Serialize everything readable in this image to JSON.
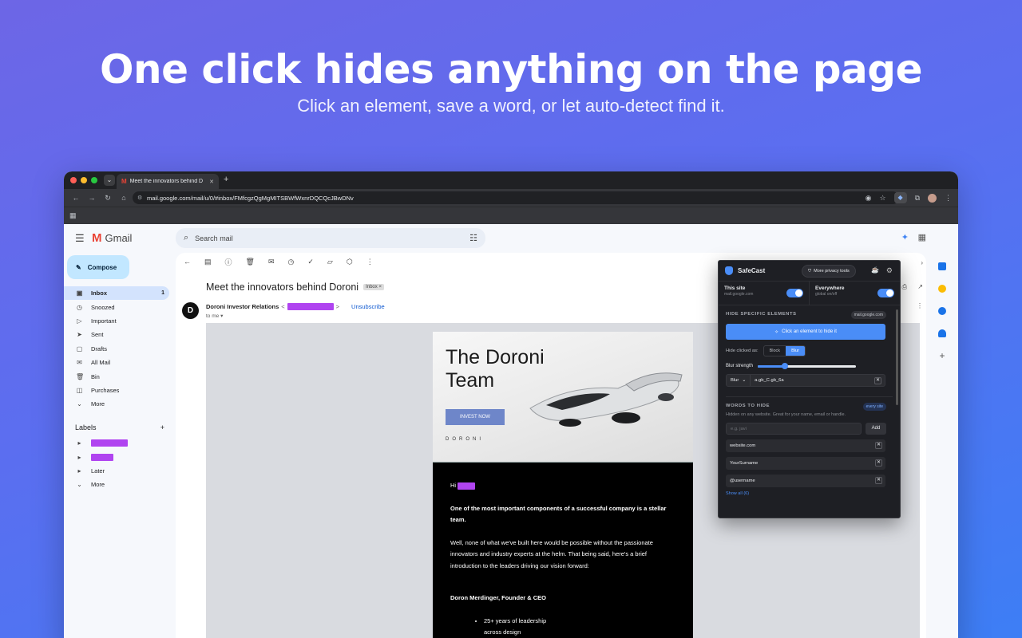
{
  "hero": {
    "title": "One click hides anything on the page",
    "subtitle": "Click an element, save a word, or let auto-detect find it."
  },
  "browser": {
    "tab_title": "Meet the innovators behind D",
    "url": "mail.google.com/mail/u/0/#inbox/FMfcgzQgMgMITSBWfWxnrDQCQcJBwDNv"
  },
  "gmail": {
    "logo": "Gmail",
    "search_placeholder": "Search mail",
    "compose": "Compose",
    "nav": [
      {
        "label": "Inbox",
        "count": "1"
      },
      {
        "label": "Snoozed"
      },
      {
        "label": "Important"
      },
      {
        "label": "Sent"
      },
      {
        "label": "Drafts"
      },
      {
        "label": "All Mail"
      },
      {
        "label": "Bin"
      },
      {
        "label": "Purchases"
      },
      {
        "label": "More"
      }
    ],
    "labels_title": "Labels",
    "labels": [
      {
        "label": "Later"
      },
      {
        "label": "More"
      }
    ]
  },
  "email": {
    "subject": "Meet the innovators behind Doroni",
    "folder_chip": "Inbox",
    "sender": "Doroni Investor Relations",
    "unsubscribe": "Unsubscribe",
    "to": "to me",
    "hero_title_line1": "The Doroni",
    "hero_title_line2": "Team",
    "invest_button": "INVEST NOW",
    "brand": "DORONI",
    "greeting": "Hi",
    "p1": "One of the most important components of a successful company is a stellar team.",
    "p2": "Well, none of what we've built here would be possible without the passionate innovators and industry experts at the helm. That being said, here's a brief introduction to the leaders driving our vision forward:",
    "p3": "Doron Merdinger, Founder & CEO",
    "bullet1": "25+ years of leadership",
    "bullet1b": "across design"
  },
  "safecast": {
    "name": "SafeCast",
    "more_tools": "More privacy tools",
    "this_site": {
      "title": "This site",
      "sub": "mail.google.com"
    },
    "everywhere": {
      "title": "Everywhere",
      "sub": "global on/off"
    },
    "hide_section": "HIDE SPECIFIC ELEMENTS",
    "site_chip": "mail.google.com",
    "click_cta": "Click an element to hide it",
    "hide_as_label": "Hide clicked as:",
    "mode_block": "Block",
    "mode_blur": "Blur",
    "blur_strength": "Blur strength",
    "blur_level": 0.28,
    "rule_mode": "Blur",
    "rule_selector": "a.gb_C.gb_6a",
    "words_section": "WORDS TO HIDE",
    "every_site_chip": "every site",
    "words_hint": "Hidden on any website. Great for your name, email or handle.",
    "word_placeholder": "e.g. javi",
    "add_button": "Add",
    "words": [
      "website.com",
      "YourSurname",
      "@username"
    ],
    "show_all": "Show all (6)"
  },
  "colors": {
    "accent": "#4a8df7",
    "redact": "#b044f0"
  }
}
